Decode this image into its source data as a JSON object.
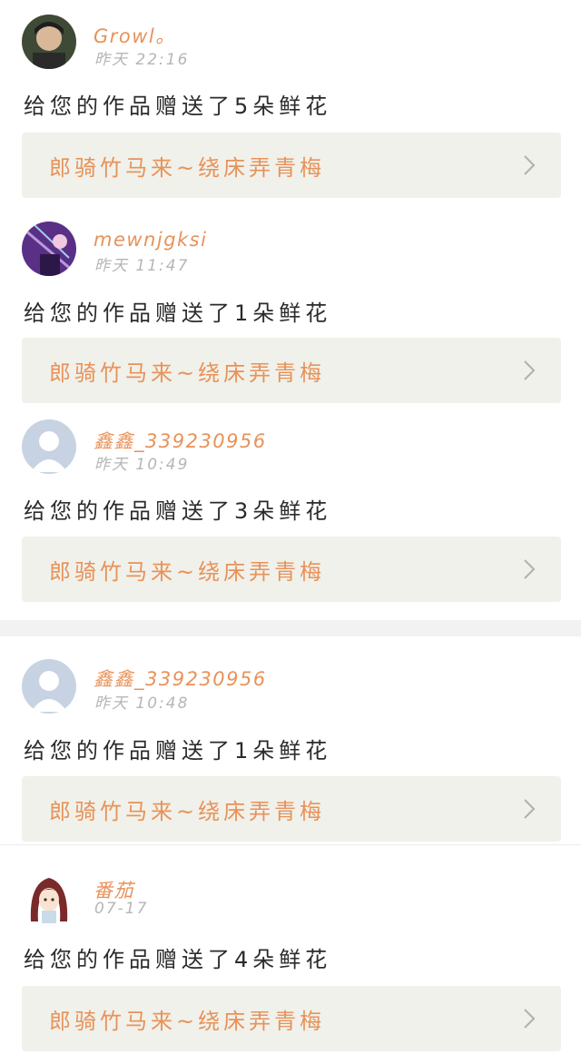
{
  "notifications": [
    {
      "username": "Growl。",
      "timestamp": "昨天 22:16",
      "message": "给您的作品赠送了5朵鲜花",
      "work_title": "郎骑竹马来~绕床弄青梅",
      "avatar": "photo-avatar-icon"
    },
    {
      "username": "mewnjgksi",
      "timestamp": "昨天 11:47",
      "message": "给您的作品赠送了1朵鲜花",
      "work_title": "郎骑竹马来~绕床弄青梅",
      "avatar": "purple-photo-avatar-icon"
    },
    {
      "username": "鑫鑫_339230956",
      "timestamp": "昨天 10:49",
      "message": "给您的作品赠送了3朵鲜花",
      "work_title": "郎骑竹马来~绕床弄青梅",
      "avatar": "default-user-avatar-icon"
    },
    {
      "username": "鑫鑫_339230956",
      "timestamp": "昨天 10:48",
      "message": "给您的作品赠送了1朵鲜花",
      "work_title": "郎骑竹马来~绕床弄青梅",
      "avatar": "default-user-avatar-icon"
    },
    {
      "username": "番茄",
      "timestamp": "07-17",
      "message": "给您的作品赠送了4朵鲜花",
      "work_title": "郎骑竹马来~绕床弄青梅",
      "avatar": "anime-girl-avatar-icon"
    }
  ],
  "colors": {
    "accent": "#e8925a",
    "card_background": "#f0f1ea",
    "timestamp": "#b6b6b6",
    "message_text": "#2b2b2b",
    "divider": "#f2f2f2"
  }
}
